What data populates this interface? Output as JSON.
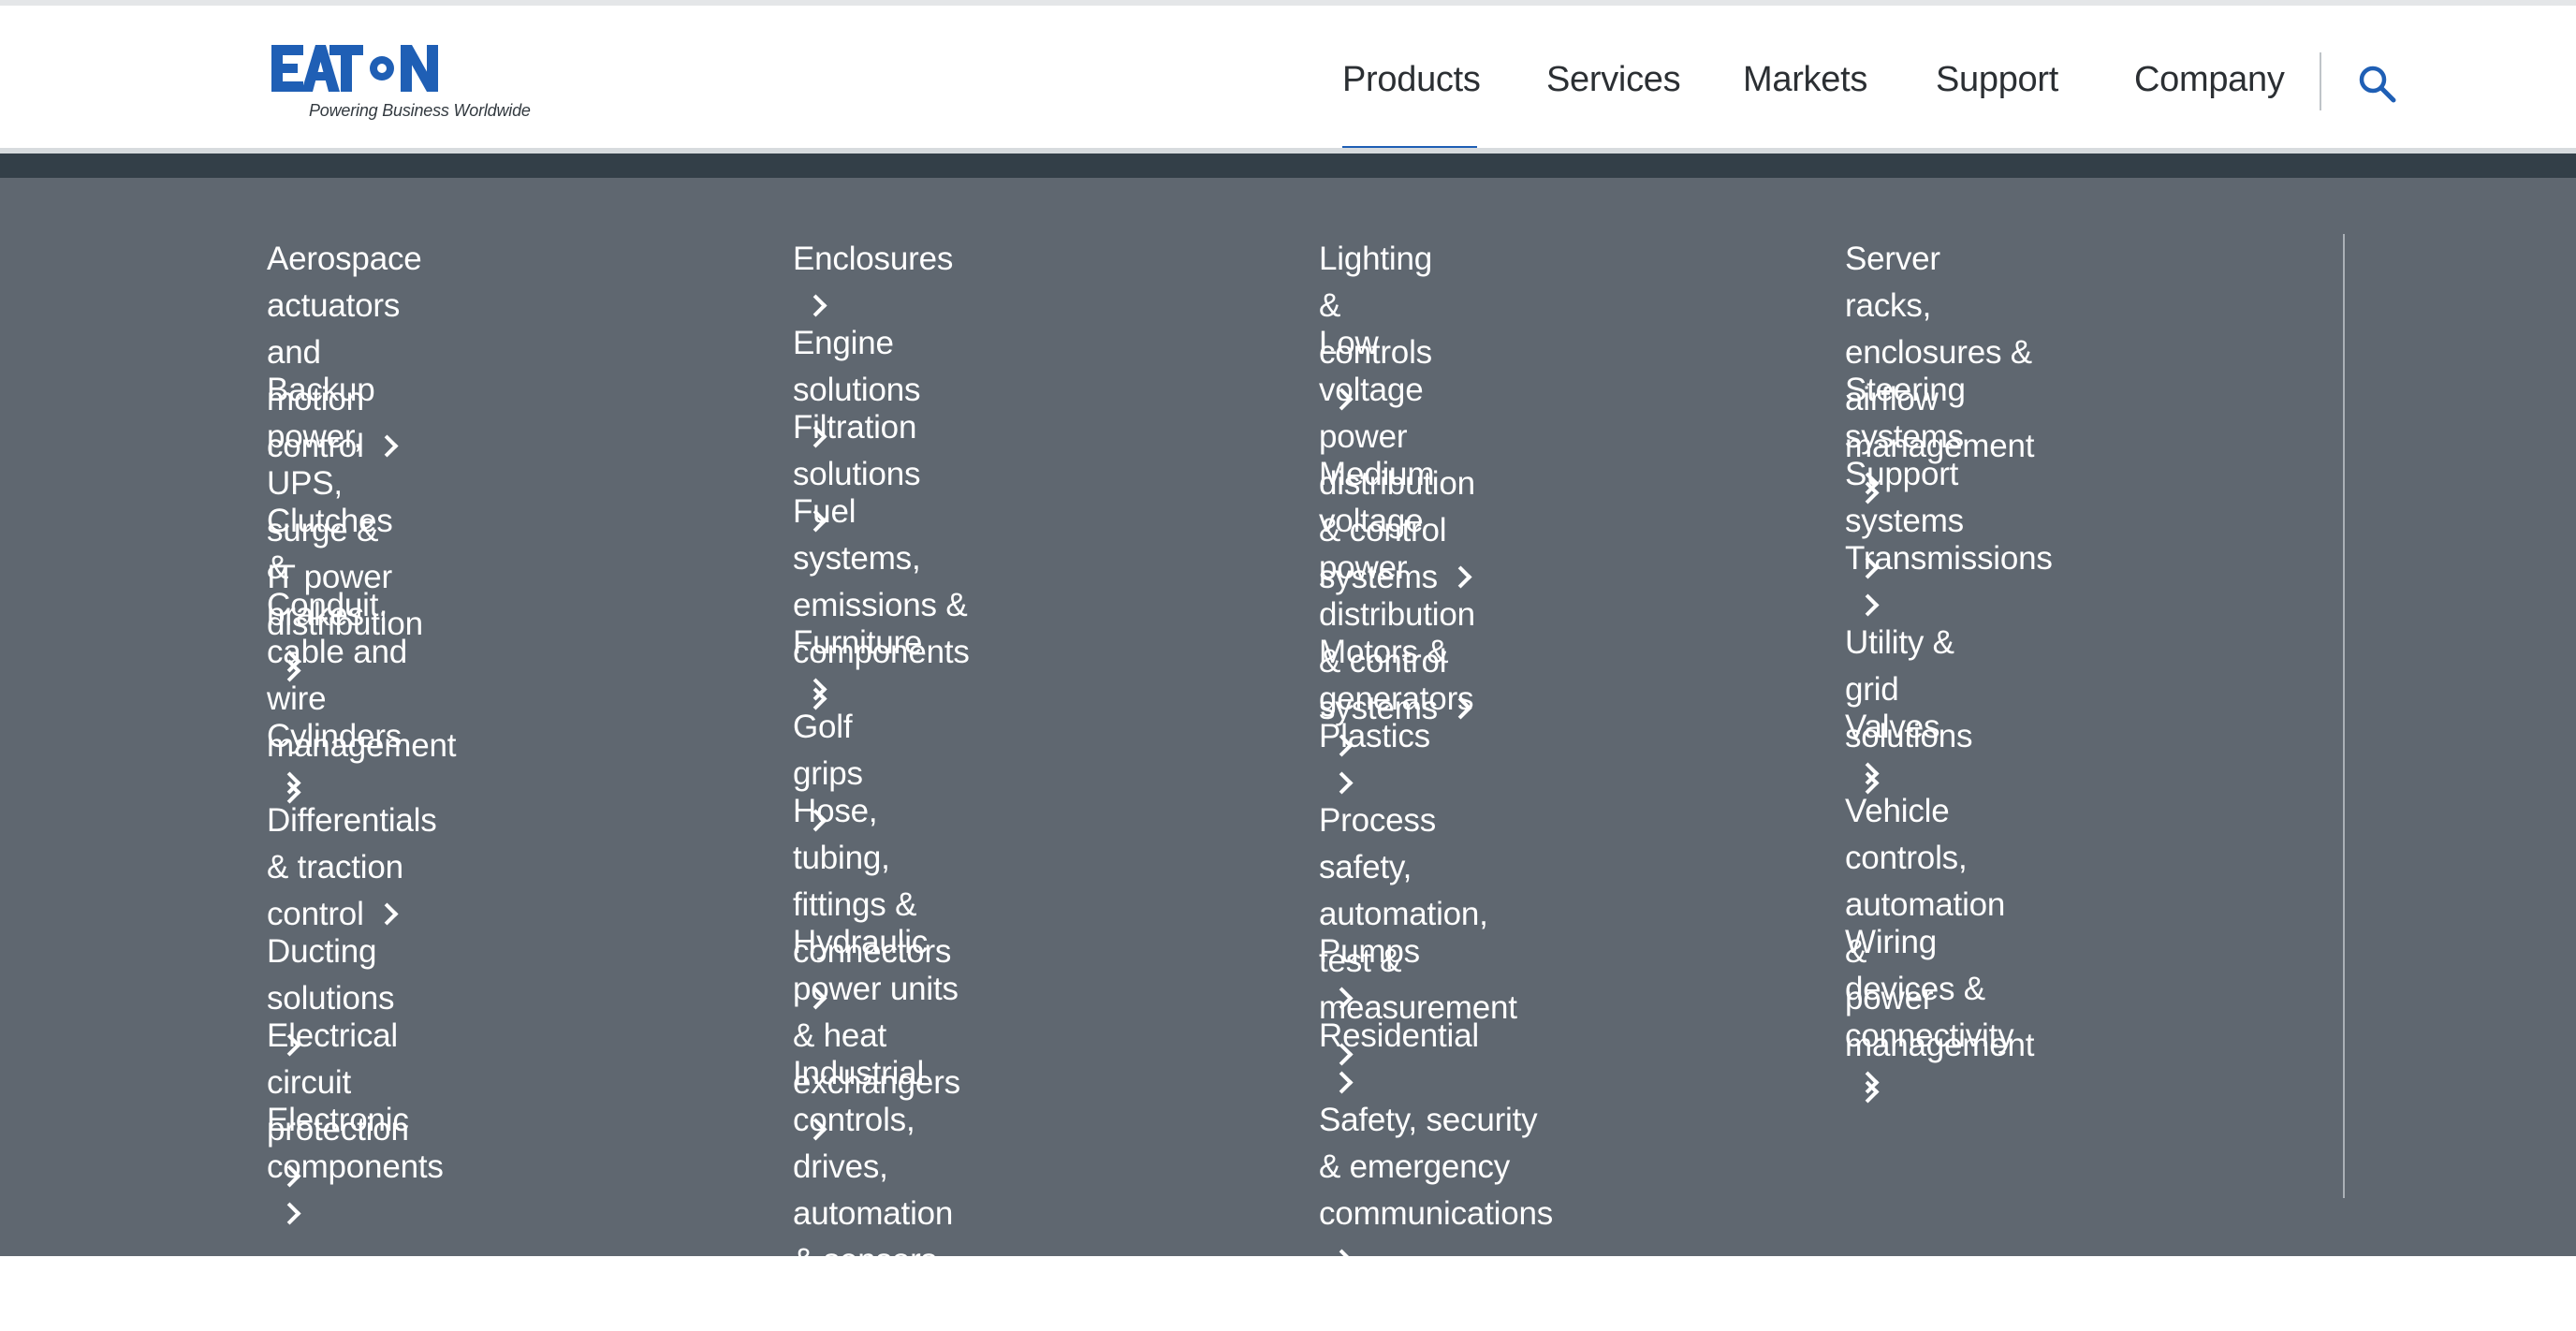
{
  "brand": {
    "name": "EATON",
    "tagline": "Powering Business Worldwide",
    "colors": {
      "logo_blue": "#1f5fb5",
      "menu_bg": "#5f6770",
      "menu_band": "#333f48"
    }
  },
  "nav": {
    "active": "Products",
    "items": [
      "Products",
      "Services",
      "Markets",
      "Support",
      "Company"
    ],
    "search_icon": "search-icon"
  },
  "menu": {
    "chevron_icon": "chevron-right-icon",
    "columns": [
      {
        "items": [
          {
            "lines": [
              "Aerospace actuators and",
              "motion control"
            ]
          },
          {
            "lines": [
              "Backup power, UPS, surge &",
              "IT power distribution"
            ]
          },
          {
            "lines": [
              "Clutches & brakes"
            ]
          },
          {
            "lines": [
              "Conduit, cable and wire",
              "management"
            ]
          },
          {
            "lines": [
              "Cylinders"
            ]
          },
          {
            "lines": [
              "Differentials & traction",
              "control"
            ]
          },
          {
            "lines": [
              "Ducting solutions"
            ]
          },
          {
            "lines": [
              "Electrical circuit protection"
            ]
          },
          {
            "lines": [
              "Electronic components"
            ]
          }
        ]
      },
      {
        "items": [
          {
            "lines": [
              "Enclosures"
            ]
          },
          {
            "lines": [
              "Engine solutions"
            ]
          },
          {
            "lines": [
              "Filtration solutions"
            ]
          },
          {
            "lines": [
              "Fuel systems, emissions &",
              "components"
            ]
          },
          {
            "lines": [
              "Furniture"
            ]
          },
          {
            "lines": [
              "Golf grips"
            ]
          },
          {
            "lines": [
              "Hose, tubing, fittings &",
              "connectors"
            ]
          },
          {
            "lines": [
              "Hydraulic power units & heat",
              "exchangers"
            ]
          },
          {
            "lines": [
              "Industrial controls, drives,",
              "automation & sensors"
            ]
          }
        ]
      },
      {
        "items": [
          {
            "lines": [
              "Lighting & controls"
            ]
          },
          {
            "lines": [
              "Low voltage power distribution",
              "& control systems"
            ]
          },
          {
            "lines": [
              "Medium voltage power",
              "distribution & control",
              "systems"
            ]
          },
          {
            "lines": [
              "Motors & generators"
            ]
          },
          {
            "lines": [
              "Plastics"
            ]
          },
          {
            "lines": [
              "Process safety, automation,",
              "test & measurement"
            ]
          },
          {
            "lines": [
              "Pumps"
            ]
          },
          {
            "lines": [
              "Residential"
            ]
          },
          {
            "lines": [
              "Safety, security & emergency",
              "communications"
            ]
          }
        ]
      },
      {
        "items": [
          {
            "lines": [
              "Server racks, enclosures &",
              "airflow management"
            ]
          },
          {
            "lines": [
              "Steering systems"
            ]
          },
          {
            "lines": [
              "Support systems"
            ]
          },
          {
            "lines": [
              "Transmissions"
            ]
          },
          {
            "lines": [
              "Utility & grid solutions"
            ]
          },
          {
            "lines": [
              "Valves"
            ]
          },
          {
            "lines": [
              "Vehicle controls, automation &",
              "power management"
            ]
          },
          {
            "lines": [
              "Wiring devices &",
              "connectivity"
            ]
          }
        ]
      }
    ]
  }
}
